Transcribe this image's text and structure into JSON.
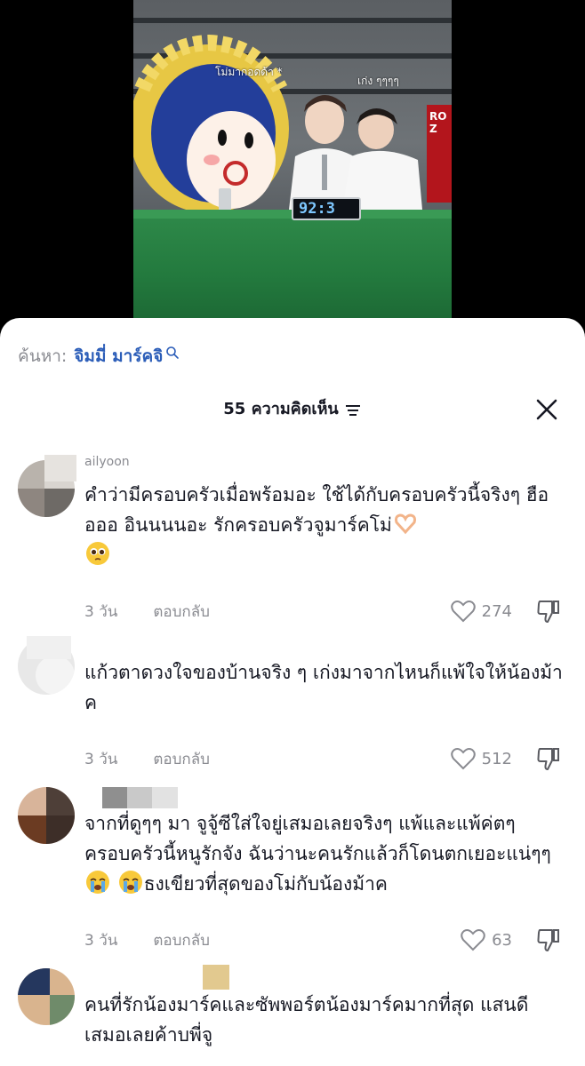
{
  "video": {
    "caption_left": "โม่มากอดด้า *",
    "caption_right": "เก่ง ๆๆๆๆ",
    "timer_display": "92:3",
    "sign_text": "RO Z"
  },
  "search": {
    "prefix": "ค้นหา:",
    "term": "จิมมี่ มาร์คจิ"
  },
  "header": {
    "count_label": "55 ความคิดเห็น"
  },
  "comments": [
    {
      "username": "ailyoon",
      "text_before_emoji": "คำว่ามีครอบครัวเมื่อพร้อมอะ ใช้ได้กับครอบครัวนี้จริงๆ ฮืออออ อินนนนอะ รักครอบครัวจูมาร์คโม่",
      "emojis": [
        "heart-hands-emoji",
        "pleading-face-emoji"
      ],
      "time": "3 วัน",
      "reply_label": "ตอบกลับ",
      "likes": "274"
    },
    {
      "username": "",
      "text": "แก้วตาดวงใจของบ้านจริง ๆ เก่งมาจากไหนก็แพ้ใจให้น้องม้าค",
      "time": "3 วัน",
      "reply_label": "ตอบกลับ",
      "likes": "512"
    },
    {
      "username": "",
      "text_part1": "จากที่ดูๆๆ มา จูจู้ซีใส่ใจยู่เสมอเลยจริงๆ แพ้และแพ้ค่ตๆ ครอบครัวนี้หนูรักจัง ฉันว่านะคนรักแล้วก็โดนตกเยอะแน่ๆๆ",
      "text_part2": "ธงเขียวที่สุดของโม่กับน้องม้าค",
      "emojis": [
        "crying-face-emoji",
        "crying-face-emoji"
      ],
      "time": "3 วัน",
      "reply_label": "ตอบกลับ",
      "likes": "63"
    },
    {
      "username": "",
      "text": "คนที่รักน้องมาร์คและซัพพอร์ตน้องมาร์คมากที่สุด แสนดีเสมอเลยค้าบพี่จู"
    }
  ],
  "colors": {
    "search_term": "#2b5db8",
    "muted_text": "#8a8b91",
    "primary_text": "#161823"
  }
}
